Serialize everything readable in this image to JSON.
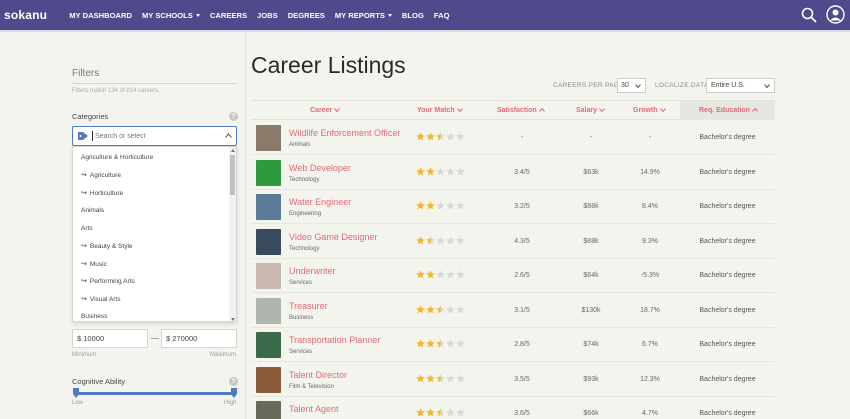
{
  "nav": {
    "brand": "sokanu",
    "items": [
      {
        "label": "MY DASHBOARD",
        "dropdown": false
      },
      {
        "label": "MY SCHOOLS",
        "dropdown": true
      },
      {
        "label": "CAREERS",
        "dropdown": false
      },
      {
        "label": "JOBS",
        "dropdown": false
      },
      {
        "label": "DEGREES",
        "dropdown": false
      },
      {
        "label": "MY REPORTS",
        "dropdown": true
      },
      {
        "label": "BLOG",
        "dropdown": false
      },
      {
        "label": "FAQ",
        "dropdown": false
      }
    ],
    "search_icon": "search-icon",
    "user_icon": "user-icon"
  },
  "sidebar": {
    "title": "Filters",
    "match_text": "Filters match 134 of 814 careers.",
    "categories_label": "Categories",
    "help_glyph": "?",
    "search_placeholder": "Search or select",
    "dropdown_items": [
      {
        "label": "Agriculture & Horticulture",
        "sub": false
      },
      {
        "label": "Agriculture",
        "sub": true
      },
      {
        "label": "Horticulture",
        "sub": true
      },
      {
        "label": "Animals",
        "sub": false
      },
      {
        "label": "Arts",
        "sub": false
      },
      {
        "label": "Beauty & Style",
        "sub": true
      },
      {
        "label": "Music",
        "sub": true
      },
      {
        "label": "Performing Arts",
        "sub": true
      },
      {
        "label": "Visual Arts",
        "sub": true
      },
      {
        "label": "Business",
        "sub": false
      }
    ],
    "salary_min": "$ 10000",
    "salary_max": "$ 270000",
    "min_label": "Minimum",
    "max_label": "Maximum",
    "cognitive_label": "Cognitive Ability",
    "low_label": "Low",
    "high_label": "High"
  },
  "main": {
    "title": "Career Listings",
    "per_page_label": "CAREERS PER PAGE",
    "per_page_value": "30",
    "localize_label": "LOCALIZE DATA",
    "localize_value": "Entire U.S.",
    "columns": {
      "career": "Career",
      "match": "Your Match",
      "satisfaction": "Satisfaction",
      "salary": "Salary",
      "growth": "Growth",
      "education": "Req. Education"
    },
    "rows": [
      {
        "title": "Wildlife Enforcement Officer",
        "category": "Animals",
        "match": 2.5,
        "satisfaction": "-",
        "salary": "-",
        "growth": "-",
        "education": "Bachelor's degree",
        "thumb_color": "#8a7a6a"
      },
      {
        "title": "Web Developer",
        "category": "Technology",
        "match": 2,
        "satisfaction": "3.4/5",
        "salary": "$63k",
        "growth": "14.9%",
        "education": "Bachelor's degree",
        "thumb_color": "#2e9a3e"
      },
      {
        "title": "Water Engineer",
        "category": "Engineering",
        "match": 2,
        "satisfaction": "3.2/5",
        "salary": "$88k",
        "growth": "8.4%",
        "education": "Bachelor's degree",
        "thumb_color": "#5a7a98"
      },
      {
        "title": "Video Game Designer",
        "category": "Technology",
        "match": 1.5,
        "satisfaction": "4.3/5",
        "salary": "$88k",
        "growth": "9.3%",
        "education": "Bachelor's degree",
        "thumb_color": "#3a4a5e"
      },
      {
        "title": "Underwriter",
        "category": "Services",
        "match": 2,
        "satisfaction": "2.6/5",
        "salary": "$64k",
        "growth": "-5.3%",
        "education": "Bachelor's degree",
        "thumb_color": "#c8b8b0"
      },
      {
        "title": "Treasurer",
        "category": "Business",
        "match": 2.5,
        "satisfaction": "3.1/5",
        "salary": "$130k",
        "growth": "18.7%",
        "education": "Bachelor's degree",
        "thumb_color": "#b0b4ae"
      },
      {
        "title": "Transportation Planner",
        "category": "Services",
        "match": 2.5,
        "satisfaction": "2.8/5",
        "salary": "$74k",
        "growth": "6.7%",
        "education": "Bachelor's degree",
        "thumb_color": "#3a6a4a"
      },
      {
        "title": "Talent Director",
        "category": "Film & Television",
        "match": 2.5,
        "satisfaction": "3.5/5",
        "salary": "$93k",
        "growth": "12.3%",
        "education": "Bachelor's degree",
        "thumb_color": "#8a5a3a"
      },
      {
        "title": "Talent Agent",
        "category": "",
        "match": 2.5,
        "satisfaction": "3.6/5",
        "salary": "$66k",
        "growth": "4.7%",
        "education": "Bachelor's degree",
        "thumb_color": "#6a6a5a"
      }
    ]
  },
  "colors": {
    "nav_bg": "#4f4a8c",
    "accent_pink": "#e06a76",
    "star_filled": "#f2b634",
    "star_empty": "#d9d9d4",
    "input_focus": "#4f7ac7"
  }
}
